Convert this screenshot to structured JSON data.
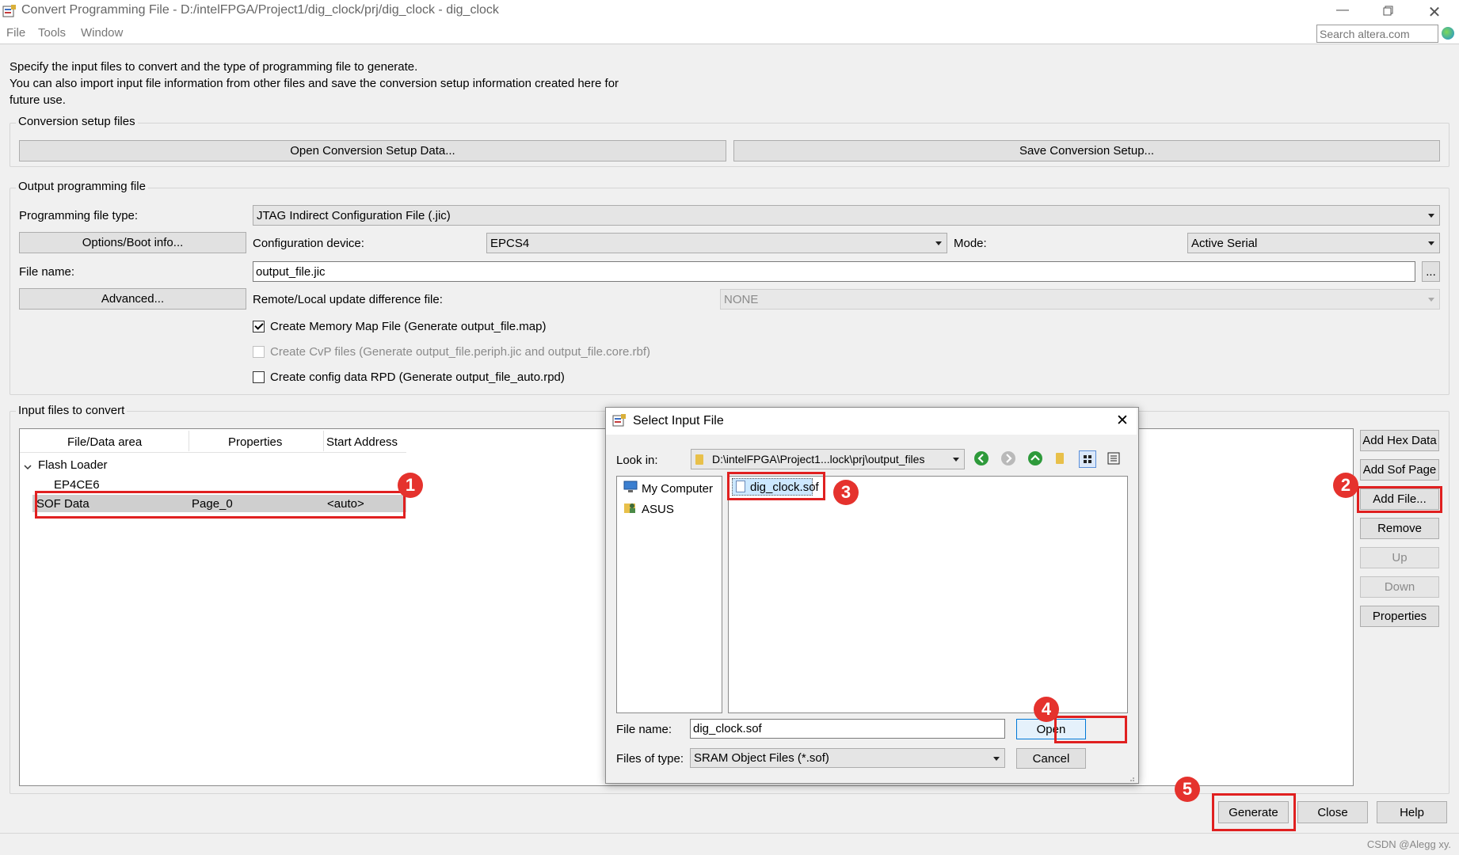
{
  "window": {
    "title": "Convert Programming File - D:/intelFPGA/Project1/dig_clock/prj/dig_clock - dig_clock",
    "menu": [
      "File",
      "Tools",
      "Window"
    ],
    "search_placeholder": "Search altera.com"
  },
  "intro": {
    "line1": "Specify the input files to convert and the type of programming file to generate.",
    "line2": "You can also import input file information from other files and save the conversion setup information created here for",
    "line3": "future use."
  },
  "conversion_setup": {
    "title": "Conversion setup files",
    "open_button": "Open Conversion Setup Data...",
    "save_button": "Save Conversion Setup..."
  },
  "output": {
    "title": "Output programming file",
    "file_type_label": "Programming file type:",
    "file_type_value": "JTAG Indirect Configuration File (.jic)",
    "options_button": "Options/Boot info...",
    "config_device_label": "Configuration device:",
    "config_device_value": "EPCS4",
    "mode_label": "Mode:",
    "mode_value": "Active Serial",
    "file_name_label": "File name:",
    "file_name_value": "output_file.jic",
    "browse_button": "...",
    "advanced_button": "Advanced...",
    "remote_label": "Remote/Local update difference file:",
    "remote_value": "NONE",
    "checkboxes": [
      {
        "label": "Create Memory Map File (Generate output_file.map)",
        "checked": true,
        "enabled": true
      },
      {
        "label": "Create CvP files (Generate output_file.periph.jic and output_file.core.rbf)",
        "checked": false,
        "enabled": false
      },
      {
        "label": "Create config data RPD (Generate output_file_auto.rpd)",
        "checked": false,
        "enabled": true
      }
    ]
  },
  "input_files": {
    "title": "Input files to convert",
    "columns": [
      "File/Data area",
      "Properties",
      "Start Address"
    ],
    "tree_root": "Flash Loader",
    "tree_child": "EP4CE6",
    "sof_row": [
      "SOF Data",
      "Page_0",
      "<auto>"
    ]
  },
  "side_buttons": {
    "add_hex": "Add Hex Data",
    "add_sof_page": "Add Sof Page",
    "add_file": "Add File...",
    "remove": "Remove",
    "up": "Up",
    "down": "Down",
    "properties": "Properties"
  },
  "bottom_buttons": {
    "generate": "Generate",
    "close": "Close",
    "help": "Help"
  },
  "dialog": {
    "title": "Select Input File",
    "look_in_label": "Look in:",
    "look_in_value": "D:\\intelFPGA\\Project1...lock\\prj\\output_files",
    "places": [
      "My Computer",
      "ASUS"
    ],
    "files": [
      "dig_clock.sof"
    ],
    "file_name_label": "File name:",
    "file_name_value": "dig_clock.sof",
    "file_type_label": "Files of type:",
    "file_type_value": "SRAM Object Files (*.sof)",
    "open_button": "Open",
    "cancel_button": "Cancel"
  },
  "badges": [
    "1",
    "2",
    "3",
    "4",
    "5"
  ],
  "watermark": "CSDN @Alegg xy.",
  "colors": {
    "annotation_red": "#e02020",
    "badge_red": "#e5322d",
    "selection_blue": "#cce8ff"
  }
}
